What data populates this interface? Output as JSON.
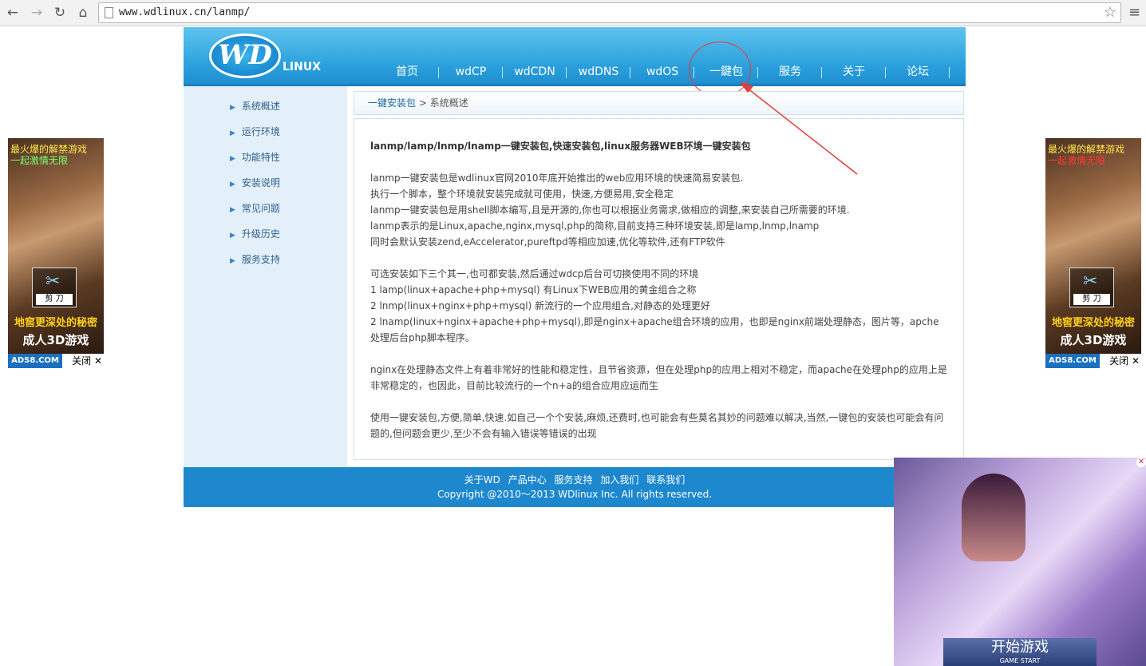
{
  "browser": {
    "url": "www.wdlinux.cn/lanmp/"
  },
  "site": {
    "logo_letters": "WD",
    "logo_suffix": "LINUX",
    "nav": [
      "首页",
      "wdCP",
      "wdCDN",
      "wdDNS",
      "wdOS",
      "一鍵包",
      "服务",
      "关于",
      "论坛"
    ],
    "sidebar": [
      "系统概述",
      "运行环境",
      "功能特性",
      "安装说明",
      "常见问题",
      "升级历史",
      "服务支持"
    ],
    "breadcrumb": {
      "link": "一键安装包",
      "sep": ">",
      "current": "系统概述"
    },
    "content": {
      "title": "lanmp/lamp/lnmp/lnamp一键安装包,快速安装包,linux服务器WEB环境一键安装包",
      "para1": [
        "lanmp一键安装包是wdlinux官网2010年底开始推出的web应用环境的快速简易安装包.",
        "执行一个脚本，整个环境就安装完成就可使用，快速,方便易用,安全稳定",
        "lanmp一键安装包是用shell脚本编写,且是开源的,你也可以根据业务需求,做相应的调整,来安装自己所需要的环境.",
        "lanmp表示的是Linux,apache,nginx,mysql,php的简称,目前支持三种环境安装,即是lamp,lnmp,lnamp",
        "同时会默认安装zend,eAccelerator,pureftpd等相应加速,优化等软件,还有FTP软件"
      ],
      "para2": [
        "可选安装如下三个其一,也可都安装,然后通过wdcp后台可切换使用不同的环境",
        "1 lamp(linux+apache+php+mysql) 有Linux下WEB应用的黄金组合之称",
        "2 lnmp(linux+nginx+php+mysql) 新流行的一个应用组合,对静态的处理更好",
        "2 lnamp(linux+nginx+apache+php+mysql),即是nginx+apache组合环境的应用，也即是nginx前端处理静态，图片等，apche处理后台php脚本程序。"
      ],
      "para3": "nginx在处理静态文件上有着非常好的性能和稳定性，且节省资源，但在处理php的应用上相对不稳定，而apache在处理php的应用上是非常稳定的，也因此，目前比较流行的一个n+a的组合应用应运而生",
      "para4": "使用一键安装包,方便,简单,快速.如自己一个个安装,麻烦,还费时,也可能会有些莫名其妙的问题难以解决,当然,一键包的安装也可能会有问题的,但问题会更少,至少不会有输入错误等错误的出现"
    },
    "footer": {
      "links": [
        "关于WD",
        "产品中心",
        "服务支持",
        "加入我们",
        "联系我们"
      ],
      "copyright": "Copyright @2010～2013 WDlinux Inc. All rights reserved."
    }
  },
  "ads": {
    "side": {
      "line1": "最火爆的解禁游戏",
      "line2": "一起激情无限",
      "scissors": "剪 刀",
      "line3": "地窖更深处的秘密",
      "line4": "成人3D游戏",
      "brand": "ADS8.COM",
      "close": "关闭 ✕"
    },
    "video": {
      "cta": "开始游戏",
      "cta_sub": "GAME START",
      "close": "✕"
    }
  },
  "colors": {
    "header_blue": "#2a9fdc",
    "footer_blue": "#1e88cf",
    "sidebar_bg": "#e4f0f9",
    "annotation_red": "#e53b3b"
  }
}
